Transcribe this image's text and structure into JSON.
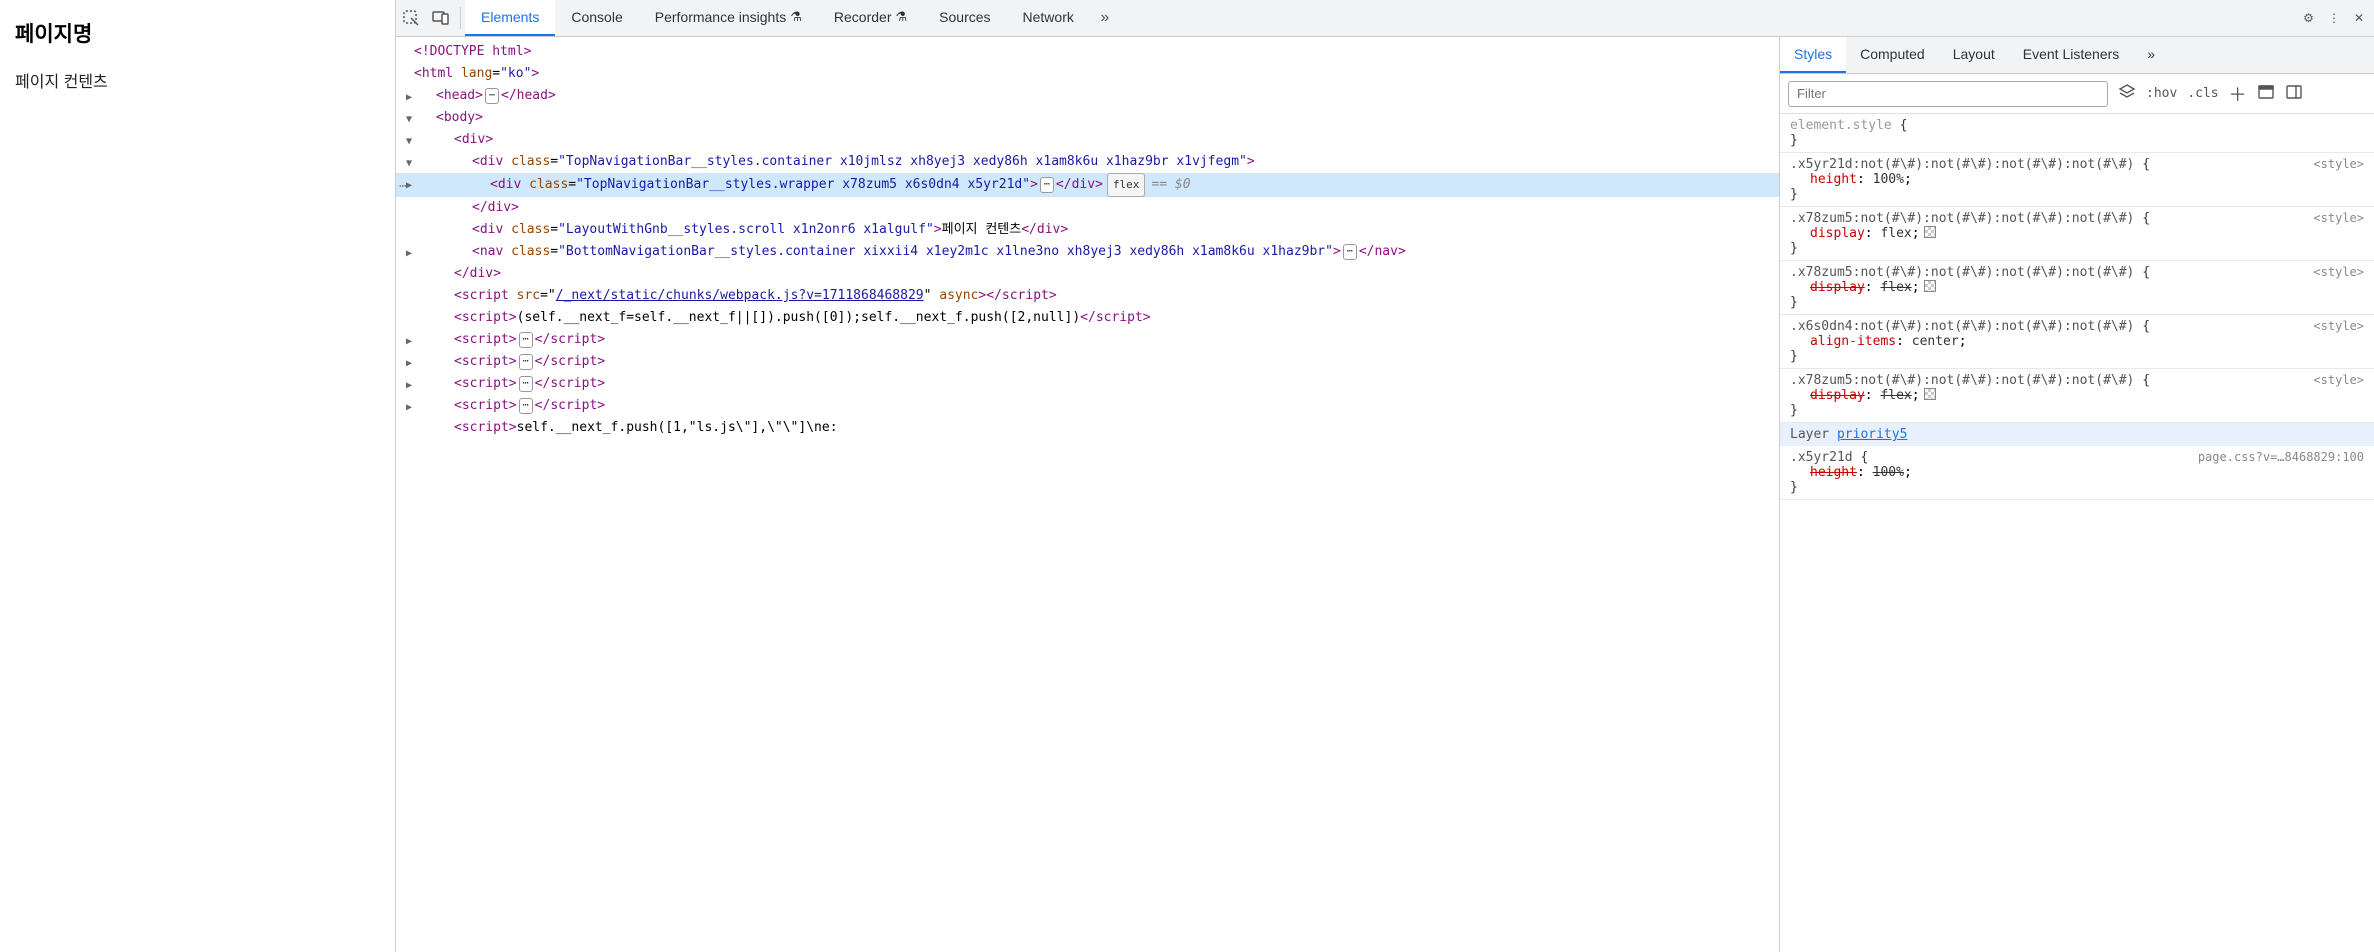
{
  "page": {
    "title": "페이지명",
    "content": "페이지 컨텐츠"
  },
  "toolbar": {
    "tabs": [
      "Elements",
      "Console",
      "Performance insights",
      "Recorder",
      "Sources",
      "Network"
    ],
    "active": 0
  },
  "dom": {
    "l0": "<!DOCTYPE html>",
    "l1a": "<",
    "l1_tag": "html",
    "l1_attr": "lang",
    "l1_val": "\"ko\"",
    "l1b": ">",
    "l2a": "<",
    "l2_tag": "head",
    "l2b": ">",
    "l2c": "</",
    "l2d": ">",
    "l3a": "<",
    "l3_tag": "body",
    "l3b": ">",
    "l4a": "<",
    "l4_tag": "div",
    "l4b": ">",
    "l5a": "<",
    "l5_tag": "div",
    "l5_attr": "class",
    "l5_val": "\"TopNavigationBar__styles.container x10jmlsz xh8yej3 xedy86h x1am8k6u x1haz9br x1vjfegm\"",
    "l5b": ">",
    "l6a": "<",
    "l6_tag": "div",
    "l6_attr": "class",
    "l6_val": "\"TopNavigationBar__styles.wrapper x78zum5 x6s0dn4 x5yr21d\"",
    "l6b": ">",
    "l6c": "</",
    "l6d": ">",
    "l6_flex": "flex",
    "l6_eq": "== $0",
    "l7a": "</",
    "l7_tag": "div",
    "l7b": ">",
    "l8a": "<",
    "l8_tag": "div",
    "l8_attr": "class",
    "l8_val": "\"LayoutWithGnb__styles.scroll x1n2onr6 x1algulf\"",
    "l8b": ">",
    "l8_text": "페이지 컨텐츠",
    "l8c": "</",
    "l8d": ">",
    "l9a": "<",
    "l9_tag": "nav",
    "l9_attr": "class",
    "l9_val": "\"BottomNavigationBar__styles.container xixxii4 x1ey2m1c x1lne3no xh8yej3 xedy86h x1am8k6u x1haz9br\"",
    "l9b": ">",
    "l9c": "</",
    "l9d": ">",
    "l10a": "</",
    "l10_tag": "div",
    "l10b": ">",
    "l11a": "<",
    "l11_tag": "script",
    "l11_attr": "src",
    "l11_link": "/_next/static/chunks/webpack.js?v=1711868468829",
    "l11_async": "async",
    "l11b": ">",
    "l11c": "</",
    "l11d": ">",
    "l12a": "<",
    "l12_tag": "script",
    "l12b": ">",
    "l12_text": "(self.__next_f=self.__next_f||[]).push([0]);self.__next_f.push([2,null])",
    "l12c": "</",
    "l12d": ">",
    "ls_a": "<",
    "ls_tag": "script",
    "ls_b": ">",
    "ls_c": "</",
    "ls_d": ">",
    "ll_a": "<",
    "ll_tag": "script",
    "ll_b": ">",
    "ll_text": "self.__next_f.push([1,\"ls.js\\\"],\\\"\\\"]\\ne:"
  },
  "styles_tabs": [
    "Styles",
    "Computed",
    "Layout",
    "Event Listeners"
  ],
  "styles_active": 0,
  "filter_placeholder": "Filter",
  "hov": ":hov",
  "cls": ".cls",
  "rules": {
    "r0_sel": "element.style",
    "r1_sel": ".x5yr21d:not(#\\#):not(#\\#):not(#\\#):not(#\\#)",
    "r1_src": "<style>",
    "r1_p": "height",
    "r1_v": "100%",
    "r2_sel": ".x78zum5:not(#\\#):not(#\\#):not(#\\#):not(#\\#)",
    "r2_src": "<style>",
    "r2_p": "display",
    "r2_v": "flex",
    "r3_sel": ".x78zum5:not(#\\#):not(#\\#):not(#\\#):not(#\\#)",
    "r3_src": "<style>",
    "r3_p": "display",
    "r3_v": "flex",
    "r4_sel": ".x6s0dn4:not(#\\#):not(#\\#):not(#\\#):not(#\\#)",
    "r4_src": "<style>",
    "r4_p": "align-items",
    "r4_v": "center",
    "r5_sel": ".x78zum5:not(#\\#):not(#\\#):not(#\\#):not(#\\#)",
    "r5_src": "<style>",
    "r5_p": "display",
    "r5_v": "flex",
    "layer_label": "Layer",
    "layer_name": "priority5",
    "r6_sel": ".x5yr21d",
    "r6_src": "page.css?v=…8468829:100",
    "r6_p": "height",
    "r6_v": "100%"
  }
}
